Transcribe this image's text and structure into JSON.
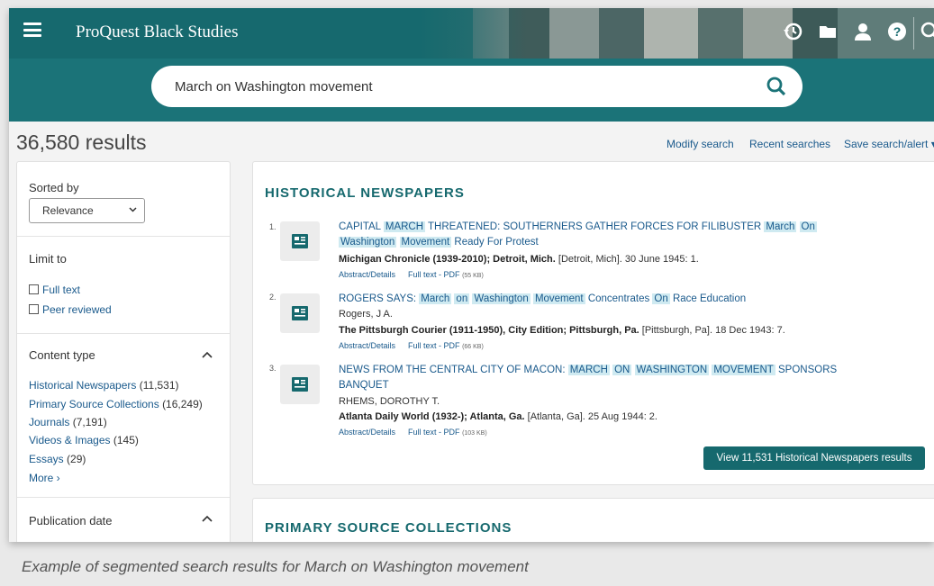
{
  "app": {
    "title": "ProQuest Black Studies"
  },
  "colors": {
    "brand": "#16696e",
    "link": "#1a5a8c",
    "highlight": "#cfeaf1"
  },
  "toolbar": {
    "icons": [
      "recent-history-icon",
      "folder-icon",
      "user-icon",
      "help-icon",
      "search-icon"
    ]
  },
  "search": {
    "query": "March on Washington movement",
    "button_icon": "search-icon"
  },
  "results": {
    "count": "36,580 results",
    "links": [
      "Modify search",
      "Recent searches",
      "Save search/alert ▾"
    ]
  },
  "sidebar": {
    "sorted_by": "Sorted by",
    "sort_value": "Relevance",
    "limit_to": "Limit to",
    "limits": [
      "Full text",
      "Peer reviewed"
    ],
    "content_type_title": "Content type",
    "content_types": [
      {
        "name": "Historical Newspapers",
        "count": "(11,531)"
      },
      {
        "name": "Primary Source Collections",
        "count": "(16,249)"
      },
      {
        "name": "Journals",
        "count": "(7,191)"
      },
      {
        "name": "Videos & Images",
        "count": "(145)"
      },
      {
        "name": "Essays",
        "count": "(29)"
      }
    ],
    "more": "More ›",
    "pub_date_title": "Publication date"
  },
  "section": {
    "title": "HISTORICAL NEWSPAPERS",
    "items": [
      {
        "num": "1.",
        "title_parts": [
          "CAPITAL ",
          "MARCH",
          " THREATENED: SOUTHERNERS GATHER FORCES FOR FILIBUSTER ",
          "March",
          " ",
          "On",
          " ",
          "Washington",
          " ",
          "Movement",
          " Ready For Protest"
        ],
        "author": "",
        "source": "Michigan Chronicle (1939-2010); Detroit, Mich.",
        "place": " [Detroit, Mich]. 30 June 1945: 1.",
        "abstract": "Abstract/Details",
        "fulltext": "Full text - PDF",
        "size": "(55 KB)"
      },
      {
        "num": "2.",
        "title_parts": [
          "ROGERS SAYS: ",
          "March",
          " ",
          "on",
          " ",
          "Washington",
          " ",
          "Movement",
          " Concentrates ",
          "On",
          " Race Education"
        ],
        "author": "Rogers, J A.",
        "source": "The Pittsburgh Courier (1911-1950), City Edition; Pittsburgh, Pa.",
        "place": " [Pittsburgh, Pa]. 18 Dec 1943: 7.",
        "abstract": "Abstract/Details",
        "fulltext": "Full text - PDF",
        "size": "(66 KB)"
      },
      {
        "num": "3.",
        "title_parts": [
          "NEWS FROM THE CENTRAL CITY OF MACON: ",
          "MARCH",
          " ",
          "ON",
          " ",
          "WASHINGTON",
          " ",
          "MOVEMENT",
          " SPONSORS BANQUET"
        ],
        "author": "RHEMS, DOROTHY T.",
        "source": "Atlanta Daily World (1932-); Atlanta, Ga.",
        "place": " [Atlanta, Ga]. 25 Aug 1944: 2.",
        "abstract": "Abstract/Details",
        "fulltext": "Full text - PDF",
        "size": "(103 KB)"
      }
    ],
    "view_button": "View 11,531 Historical Newspapers results"
  },
  "section2": {
    "title": "PRIMARY SOURCE COLLECTIONS"
  },
  "caption": "Example of segmented search results for March on Washington movement"
}
